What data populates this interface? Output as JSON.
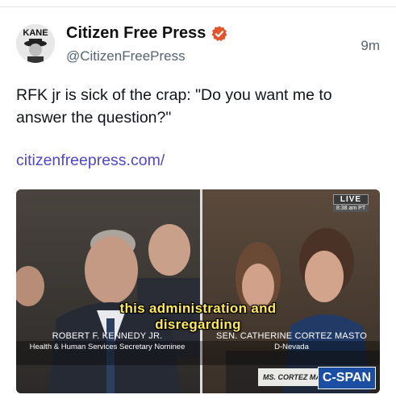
{
  "tweet": {
    "display_name": "Citizen Free Press",
    "handle": "@CitizenFreePress",
    "time": "9m",
    "avatar_text": "KANE",
    "text": "RFK jr is sick of the crap: \"Do you want me to answer the question?\"",
    "link": "citizenfreepress.com/"
  },
  "video": {
    "caption_line1": "this administration and",
    "caption_line2": "disregarding",
    "left_name": "ROBERT F. KENNEDY JR.",
    "left_title": "Health & Human Services Secretary Nominee",
    "right_name": "SEN. CATHERINE CORTEZ MASTO",
    "right_title": "D-Nevada",
    "live_label": "LIVE",
    "live_time": "8:38 am PT",
    "speaker_bar": "MS. CORTEZ MA",
    "network": "C-SPAN"
  },
  "colors": {
    "link": "#4f46c8",
    "verified": "#e2552d",
    "caption": "#ffe85a",
    "cspan": "#1b4fa3"
  }
}
